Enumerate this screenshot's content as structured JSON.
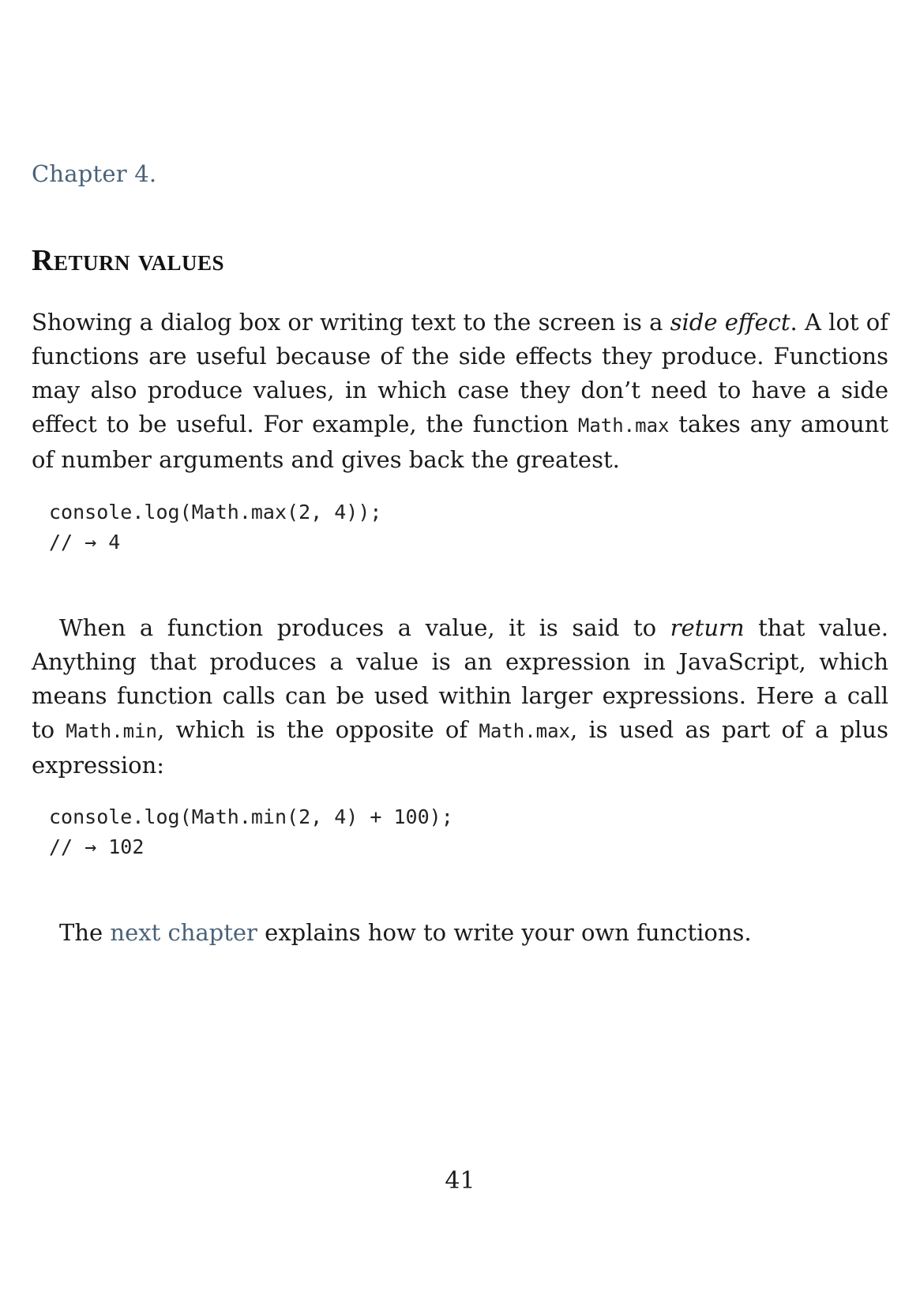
{
  "chapter_label": "Chapter 4.",
  "section_title": "Return values",
  "paragraph1": {
    "part1": "Showing a dialog box or writing text to the screen is a ",
    "emph": "side effect",
    "part2": ". A lot of functions are useful because of the side effects they produce. Functions may also produce values, in which case they don’t need to have a side effect to be useful. For example, the function ",
    "code": "Math.max",
    "part3": " takes any amount of number arguments and gives back the greatest."
  },
  "code_block1": {
    "line1": "console.log(Math.max(2, 4));",
    "line2": "// → 4"
  },
  "paragraph2": {
    "part1": "When a function produces a value, it is said to ",
    "emph": "return",
    "part2": " that value. Anything that produces a value is an expression in JavaScript, which means function calls can be used within larger expressions. Here a call to ",
    "code1": "Math.min",
    "part3": ", which is the opposite of ",
    "code2": "Math.max",
    "part4": ", is used as part of a plus expression:"
  },
  "code_block2": {
    "line1": "console.log(Math.min(2, 4) + 100);",
    "line2": "// → 102"
  },
  "paragraph3": {
    "part1": "The ",
    "link": "next chapter",
    "part2": " explains how to write your own functions."
  },
  "page_number": "41",
  "colors": {
    "accent": "#4a6278",
    "text": "#1a1a1a"
  }
}
